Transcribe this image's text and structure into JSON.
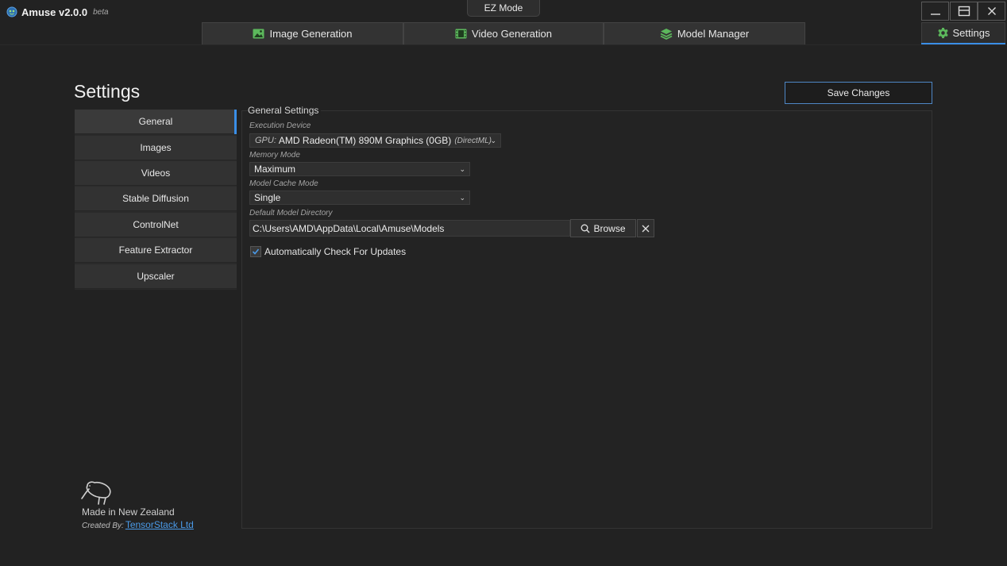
{
  "app": {
    "name": "Amuse v2.0.0",
    "beta": "beta",
    "ez_mode": "EZ Mode"
  },
  "tabs": [
    {
      "label": "Image Generation",
      "icon": "image-icon"
    },
    {
      "label": "Video Generation",
      "icon": "film-icon"
    },
    {
      "label": "Model Manager",
      "icon": "layers-icon"
    }
  ],
  "settings_tab": {
    "label": "Settings",
    "icon": "gear-icon"
  },
  "page": {
    "title": "Settings",
    "save_label": "Save Changes"
  },
  "sidebar": {
    "items": [
      {
        "label": "General",
        "active": true
      },
      {
        "label": "Images"
      },
      {
        "label": "Videos"
      },
      {
        "label": "Stable Diffusion"
      },
      {
        "label": "ControlNet"
      },
      {
        "label": "Feature Extractor"
      },
      {
        "label": "Upscaler"
      }
    ]
  },
  "general": {
    "group_title": "General Settings",
    "execution_device": {
      "label": "Execution Device",
      "prefix": "GPU:",
      "value": "AMD Radeon(TM) 890M Graphics (0GB)",
      "suffix": "(DirectML)"
    },
    "memory_mode": {
      "label": "Memory Mode",
      "value": "Maximum"
    },
    "model_cache_mode": {
      "label": "Model Cache Mode",
      "value": "Single"
    },
    "default_model_directory": {
      "label": "Default Model Directory",
      "value": "C:\\Users\\AMD\\AppData\\Local\\Amuse\\Models",
      "browse_label": "Browse"
    },
    "auto_update": {
      "label": "Automatically Check For Updates",
      "checked": true
    }
  },
  "footer": {
    "made_in": "Made in New Zealand",
    "created_by": "Created By:",
    "company": "TensorStack Ltd"
  },
  "colors": {
    "accent": "#3a8ee6",
    "green_icon": "#5cb85c",
    "link": "#4a9ae8"
  }
}
